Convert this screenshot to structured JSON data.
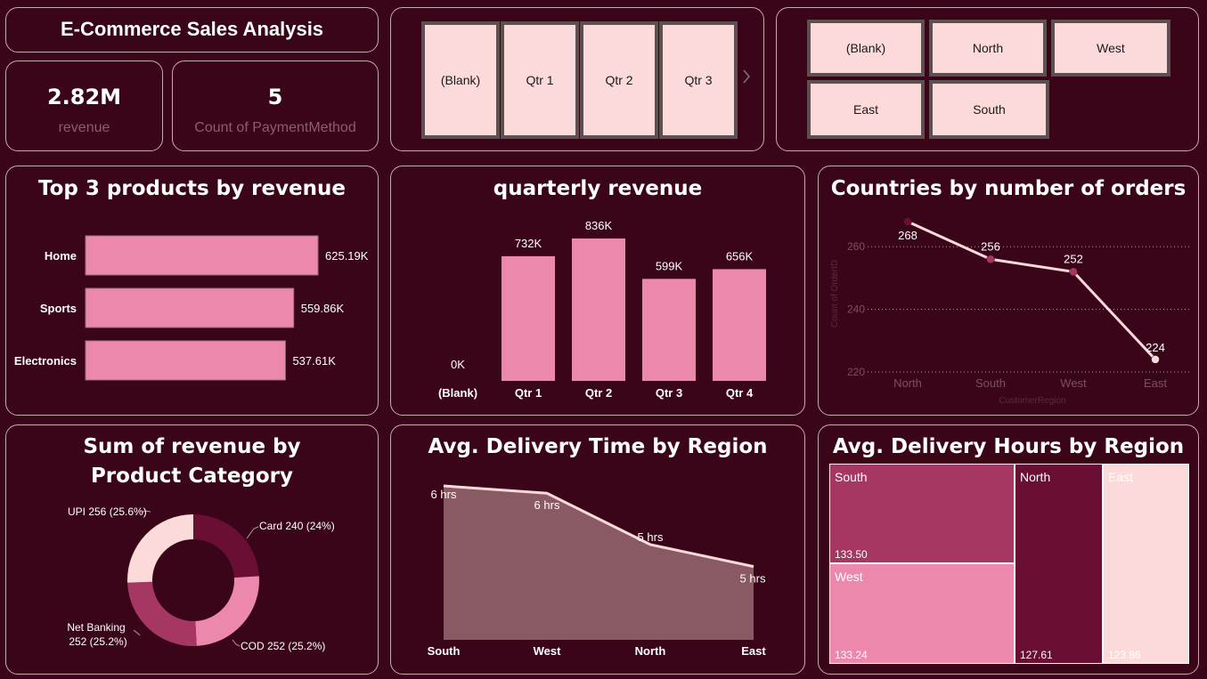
{
  "header": {
    "title": "E-Commerce Sales Analysis"
  },
  "kpis": [
    {
      "value": "2.82M",
      "label": "revenue"
    },
    {
      "value": "5",
      "label": "Count of PaymentMethod"
    }
  ],
  "quarter_slicer": {
    "items": [
      "(Blank)",
      "Qtr 1",
      "Qtr 2",
      "Qtr 3"
    ]
  },
  "region_slicer": {
    "items": [
      "(Blank)",
      "North",
      "West",
      "East",
      "South"
    ]
  },
  "colors": {
    "background": "#3a0519",
    "bar_pink": "#ec87ad",
    "light_pink": "#fcdada",
    "dark_wine": "#6b0e33",
    "mid_wine": "#a63763"
  },
  "icons": {
    "next": "chevron-right-icon"
  },
  "top_products": {
    "title": "Top 3 products by revenue",
    "chart_data": {
      "type": "bar",
      "orientation": "horizontal",
      "categories": [
        "Home",
        "Sports",
        "Electronics"
      ],
      "values": [
        625190,
        559860,
        537610
      ],
      "labels": [
        "625.19K",
        "559.86K",
        "537.61K"
      ]
    }
  },
  "quarterly": {
    "title": "quarterly revenue",
    "chart_data": {
      "type": "bar",
      "categories": [
        "(Blank)",
        "Qtr 1",
        "Qtr 2",
        "Qtr 3",
        "Qtr 4"
      ],
      "values": [
        0,
        732000,
        836000,
        599000,
        656000
      ],
      "labels": [
        "0K",
        "732K",
        "836K",
        "599K",
        "656K"
      ]
    }
  },
  "countries": {
    "title": "Countries by number of orders",
    "chart_data": {
      "type": "line",
      "categories": [
        "North",
        "South",
        "West",
        "East"
      ],
      "values": [
        268,
        256,
        252,
        224
      ],
      "xlabel": "CustomerRegion",
      "ylabel": "Count of OrderID",
      "yticks": [
        "220",
        "240",
        "260"
      ],
      "ylim": [
        220,
        270
      ],
      "grid": true
    }
  },
  "category_pie": {
    "title": "Sum of revenue by Product Category",
    "chart_data": {
      "type": "pie",
      "donut": true,
      "slices": [
        {
          "name": "Card",
          "value": 240,
          "label": "Card 240 (24%)",
          "color": "#6b0e33"
        },
        {
          "name": "COD",
          "value": 252,
          "label": "COD 252 (25.2%)",
          "color": "#ec87ad"
        },
        {
          "name": "Net Banking",
          "value": 252,
          "label_line1": "Net Banking",
          "label_line2": "252 (25.2%)",
          "color": "#a63763"
        },
        {
          "name": "UPI",
          "value": 256,
          "label": "UPI 256 (25.6%)",
          "color": "#fcdada"
        }
      ]
    }
  },
  "delivery_time": {
    "title": "Avg. Delivery Time by Region",
    "chart_data": {
      "type": "area",
      "categories": [
        "South",
        "West",
        "North",
        "East"
      ],
      "values": [
        6.1,
        6.0,
        5.3,
        5.0
      ],
      "labels": [
        "6 hrs",
        "6 hrs",
        "5 hrs",
        "5 hrs"
      ]
    }
  },
  "delivery_hours": {
    "title": "Avg. Delivery Hours by Region",
    "chart_data": {
      "type": "treemap",
      "items": [
        {
          "name": "South",
          "value": 133.5,
          "label": "133.50",
          "color": "#a63763"
        },
        {
          "name": "West",
          "value": 133.24,
          "label": "133.24",
          "color": "#ec87ad"
        },
        {
          "name": "North",
          "value": 127.61,
          "label": "127.61",
          "color": "#6b0e33"
        },
        {
          "name": "East",
          "value": 123.86,
          "label": "123.86",
          "color": "#fcdada"
        }
      ]
    }
  }
}
